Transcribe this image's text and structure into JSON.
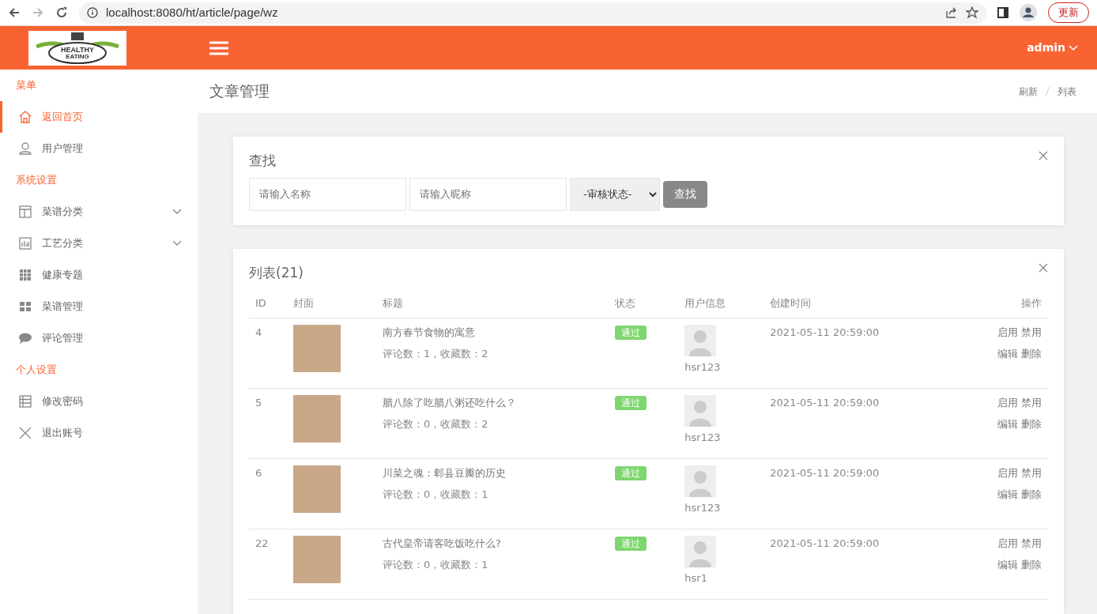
{
  "browser": {
    "url": "localhost:8080/ht/article/page/wz",
    "update_button": "更新"
  },
  "header": {
    "logo": {
      "line_1": "HEALTHY",
      "line_2": "EATING"
    },
    "user": "admin"
  },
  "sidebar": {
    "items": [
      {
        "kind": "heading",
        "label": "菜单"
      },
      {
        "kind": "item",
        "label": "返回首页",
        "selected": true
      },
      {
        "kind": "item",
        "label": "用户管理",
        "selected": false
      },
      {
        "kind": "heading",
        "label": "系统设置"
      },
      {
        "kind": "item",
        "label": "菜谱分类",
        "selected": false,
        "expanded": false
      },
      {
        "kind": "item",
        "label": "工艺分类",
        "selected": false,
        "expanded": false
      },
      {
        "kind": "item",
        "label": "健康专题",
        "selected": false
      },
      {
        "kind": "item",
        "label": "菜谱管理",
        "selected": false
      },
      {
        "kind": "item",
        "label": "评论管理",
        "selected": false
      },
      {
        "kind": "heading",
        "label": "个人设置"
      },
      {
        "kind": "item",
        "label": "修改密码",
        "selected": false
      },
      {
        "kind": "item",
        "label": "退出账号",
        "selected": false
      }
    ]
  },
  "page_title": "文章管理",
  "breadcrumb": [
    "刷新",
    "列表"
  ],
  "search_panel": {
    "title": "查找",
    "name_field": {
      "placeholder": "请输入名称"
    },
    "nickname_field": {
      "placeholder": "请输入昵称"
    },
    "status_select": "-审核状态-",
    "button": "查找"
  },
  "list_panel": {
    "title": "列表(21)",
    "columns": [
      "ID",
      "封面",
      "标题",
      "状态",
      "用户信息",
      "创建时间",
      "操作"
    ],
    "rows": [
      {
        "id": "4",
        "title": "南方春节食物的寓意",
        "stats": "评论数：1，收藏数：2",
        "status": "通过",
        "user": "hsr123",
        "created": "2021-05-11 20:59:00",
        "actions": [
          "启用",
          "禁用",
          "编辑",
          "删除"
        ]
      },
      {
        "id": "5",
        "title": "腊八除了吃腊八粥还吃什么？",
        "stats": "评论数：0，收藏数：2",
        "status": "通过",
        "user": "hsr123",
        "created": "2021-05-11 20:59:00",
        "actions": [
          "启用",
          "禁用",
          "编辑",
          "删除"
        ]
      },
      {
        "id": "6",
        "title": "川菜之魂：郫县豆瓣的历史",
        "stats": "评论数：0，收藏数：1",
        "status": "通过",
        "user": "hsr123",
        "created": "2021-05-11 20:59:00",
        "actions": [
          "启用",
          "禁用",
          "编辑",
          "删除"
        ]
      },
      {
        "id": "22",
        "title": "古代皇帝请客吃饭吃什么?",
        "stats": "评论数：0，收藏数：1",
        "status": "通过",
        "user": "hsr1",
        "created": "2021-05-11 20:59:00",
        "actions": [
          "启用",
          "禁用",
          "编辑",
          "删除"
        ]
      }
    ]
  }
}
